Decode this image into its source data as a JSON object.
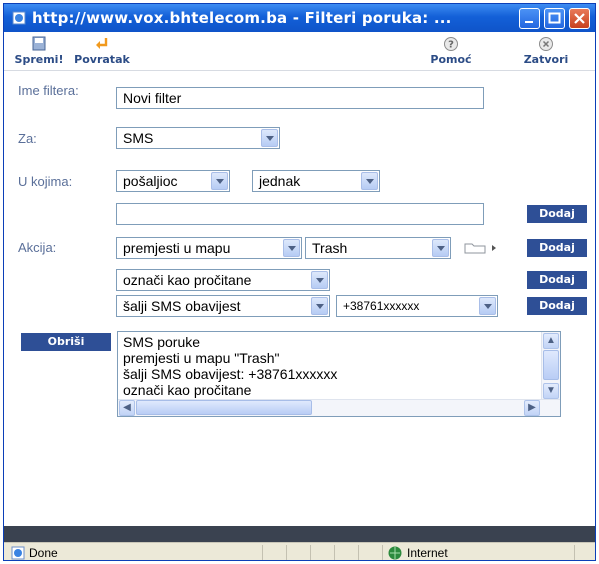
{
  "window": {
    "title": "http://www.vox.bhtelecom.ba - Filteri poruka: ..."
  },
  "toolbar": {
    "save_label": "Spremi!",
    "back_label": "Povratak",
    "help_label": "Pomoć",
    "close_label": "Zatvori"
  },
  "form": {
    "name_label": "Ime filtera:",
    "name_value": "Novi filter",
    "for_label": "Za:",
    "for_value": "SMS",
    "where_label": "U kojima:",
    "where_field_value": "pošaljioc",
    "where_operator_value": "jednak",
    "condition_value": "",
    "add_label": "Dodaj",
    "action_label": "Akcija:",
    "action1_value": "premjesti u mapu",
    "folder_value": "Trash",
    "action2_value": "označi kao pročitane",
    "action3_value": "šalji SMS obavijest",
    "phone_value": "+38761xxxxxx",
    "delete_label": "Obriši"
  },
  "summary": {
    "lines": [
      "SMS poruke",
      "premjesti u mapu \"Trash\"",
      "šalji SMS obavijest:  +38761xxxxxx",
      "označi kao pročitane"
    ]
  },
  "status": {
    "left": "Done",
    "zone": "Internet"
  }
}
